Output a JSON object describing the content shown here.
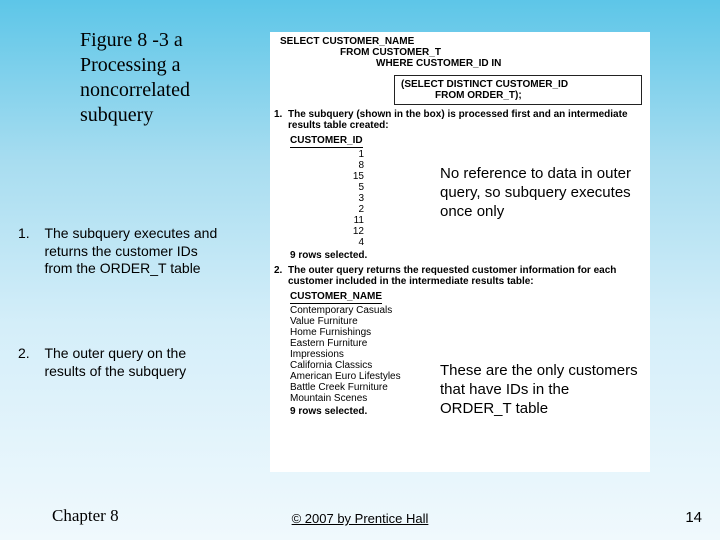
{
  "title": "Figure 8 -3 a Processing a noncorrelated subquery",
  "steps": {
    "s1_num": "1.",
    "s1_text": "The subquery executes and returns the customer IDs from the ORDER_T table",
    "s2_num": "2.",
    "s2_text": "The outer query on the results of the subquery"
  },
  "sql": {
    "outer": {
      "l1": "SELECT CUSTOMER_NAME",
      "l2": "FROM CUSTOMER_T",
      "l3": "WHERE CUSTOMER_ID IN"
    },
    "inner": {
      "l1": "(SELECT DISTINCT CUSTOMER_ID",
      "l2": "FROM ORDER_T);"
    }
  },
  "fig": {
    "step1_num": "1.",
    "step1_text": "The subquery (shown in the box) is processed first and an intermediate results table created:",
    "col_id": "CUSTOMER_ID",
    "ids": [
      "1",
      "8",
      "15",
      "5",
      "3",
      "2",
      "11",
      "12",
      "4"
    ],
    "rows1": "9 rows selected.",
    "step2_num": "2.",
    "step2_text": "The outer query returns the requested customer information for each customer included in the intermediate results table:",
    "col_name": "CUSTOMER_NAME",
    "names": [
      "Contemporary Casuals",
      "Value Furniture",
      "Home Furnishings",
      "Eastern Furniture",
      "Impressions",
      "California Classics",
      "American Euro Lifestyles",
      "Battle Creek Furniture",
      "Mountain Scenes"
    ],
    "rows2": "9 rows selected."
  },
  "callouts": {
    "c1": "No reference to data in outer query, so subquery executes once only",
    "c2": "These are the only customers that have IDs in the ORDER_T table"
  },
  "footer": {
    "chapter": "Chapter 8",
    "copyright": "© 2007 by Prentice Hall",
    "page": "14"
  }
}
